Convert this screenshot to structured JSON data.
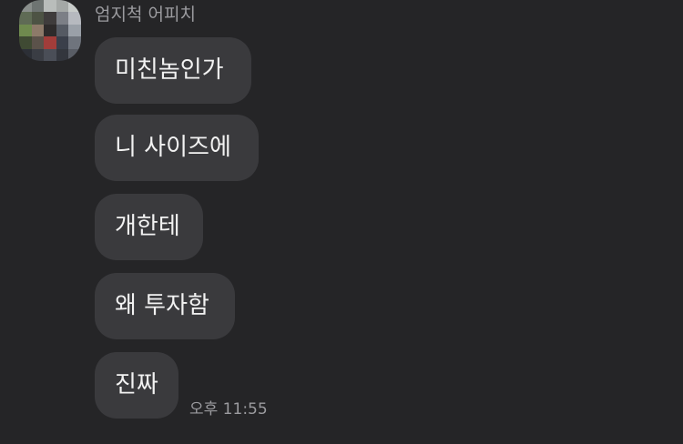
{
  "sender": {
    "name": "엄지척 어피치"
  },
  "messages": [
    {
      "text": "미친놈인가"
    },
    {
      "text": "니 사이즈에"
    },
    {
      "text": "개한테"
    },
    {
      "text": "왜 투자함"
    },
    {
      "text": "진짜"
    }
  ],
  "last_message_time": "오후 11:55",
  "colors": {
    "background": "#252527",
    "bubble": "#3a3a3d",
    "bubble_text": "#f2f2f2",
    "meta_text": "#9b9b9f"
  }
}
